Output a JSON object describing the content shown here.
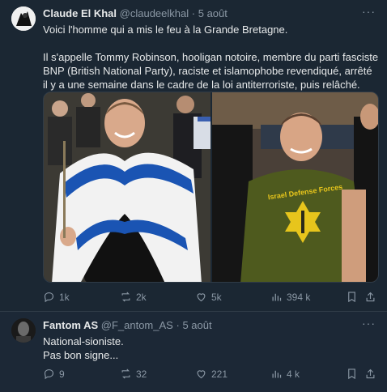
{
  "tweet": {
    "name": "Claude El Khal",
    "handle": "@claudeelkhal",
    "separator": "·",
    "date": "5 août",
    "more": "···",
    "text_line1": "Voici l'homme qui a mis le feu à la Grande Bretagne.",
    "text_line2": "Il s'appelle Tommy Robinson, hooligan notoire, membre du parti fasciste BNP (British National Party), raciste et islamophobe revendiqué, arrêté il y a une semaine dans le cadre de la loi antiterroriste, puis relâché.",
    "shirt_text": "Israel Defense Forces",
    "stats": {
      "replies": "1k",
      "retweets": "2k",
      "likes": "5k",
      "views": "394 k"
    }
  },
  "reply": {
    "name": "Fantom AS",
    "handle": "@F_antom_AS",
    "separator": "·",
    "date": "5 août",
    "more": "···",
    "line1": "National-sioniste.",
    "line2": "Pas bon signe...",
    "stats": {
      "replies": "9",
      "retweets": "32",
      "likes": "221",
      "views": "4 k"
    }
  },
  "colors": {
    "background": "#15202b",
    "card": "#1b2733",
    "muted": "#8b98a5",
    "text": "#e7e9ea",
    "flag_blue": "#1a54b3",
    "shirt": "#4e5a1e",
    "star": "#e7c51c"
  }
}
